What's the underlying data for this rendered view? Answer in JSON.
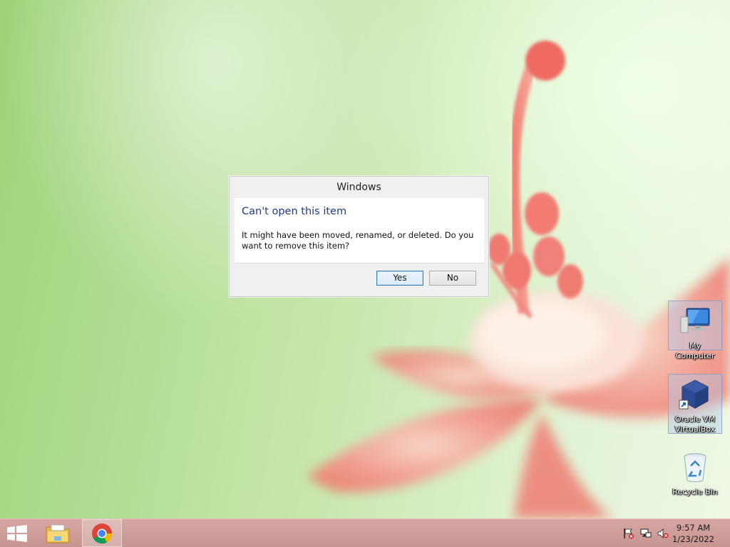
{
  "dialog": {
    "title": "Windows",
    "heading": "Can't open this item",
    "message": "It might have been moved, renamed, or deleted. Do you want to remove this item?",
    "yes_label": "Yes",
    "no_label": "No"
  },
  "desktop_icons": [
    {
      "label": "My Computer",
      "icon": "computer-icon"
    },
    {
      "label": "Oracle VM VirtualBox",
      "icon": "virtualbox-icon"
    },
    {
      "label": "Recycle Bin",
      "icon": "recycle-bin-icon"
    }
  ],
  "taskbar": {
    "pinned": [
      {
        "name": "start",
        "icon": "windows-logo-icon"
      },
      {
        "name": "file-explorer",
        "icon": "folder-icon"
      },
      {
        "name": "chrome",
        "icon": "chrome-icon"
      }
    ],
    "tray": [
      "action-center-flag-icon",
      "network-icon",
      "volume-muted-icon"
    ],
    "clock": {
      "time": "9:57 AM",
      "date": "1/23/2022"
    }
  },
  "colors": {
    "dialog_heading": "#1f3c88",
    "taskbar": "#c99894",
    "wallpaper_green": "#b7e09a",
    "flower_pink": "#f08a80"
  }
}
